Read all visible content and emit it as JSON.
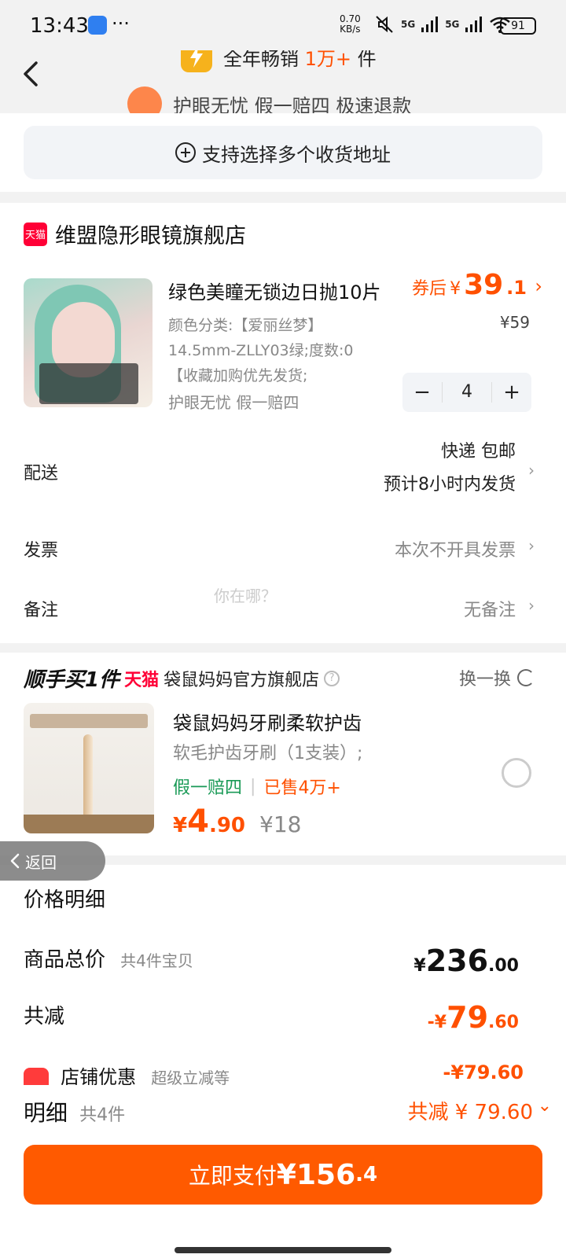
{
  "status_bar": {
    "time": "13:43",
    "dots": "···",
    "net_speed_top": "0.70",
    "net_speed_bottom": "KB/s",
    "signal1": "5G",
    "signal2": "5G",
    "battery": "91"
  },
  "top_banner": {
    "promo1_prefix": "全年畅销",
    "promo1_highlight": "1万+",
    "promo1_suffix": "件",
    "promo2": "护眼无忧 假一赔四 极速退款"
  },
  "address": {
    "label": "支持选择多个收货地址"
  },
  "shop": {
    "badge": "天猫",
    "name": "维盟隐形眼镜旗舰店",
    "product": {
      "title": "绿色美瞳无锁边日抛10片",
      "coupon_prefix": "券后",
      "coupon_currency": "¥",
      "coupon_int": "39",
      "coupon_dec": ".1",
      "orig_price": "¥59",
      "spec_line1": "颜色分类:【爱丽丝梦】",
      "spec_line2": "14.5mm-ZLLY03绿;度数:0",
      "spec_line3": "【收藏加购优先发货;",
      "tags": "护眼无忧  假一赔四",
      "quantity": "4",
      "minus": "−",
      "plus": "+"
    },
    "shipping_label": "配送",
    "shipping_value1": "快递 包邮",
    "shipping_value2": "预计8小时内发货",
    "invoice_label": "发票",
    "invoice_value": "本次不开具发票",
    "note_label": "备注",
    "note_value": "无备注",
    "ghost_text": "你在哪？"
  },
  "addon": {
    "brand": "顺手买1件",
    "tmall": "天猫",
    "shop": "袋鼠妈妈官方旗舰店",
    "help": "?",
    "swap": "换一换",
    "title": "袋鼠妈妈牙刷柔软护齿",
    "spec": "软毛护齿牙刷（1支装）;",
    "tag1": "假一赔四",
    "tag_sep": "|",
    "tag2": "已售4万+",
    "price_cur": "¥",
    "price_int": "4",
    "price_dec": ".90",
    "orig_price": "¥18"
  },
  "back_float": "返回",
  "price_detail": {
    "title": "价格明细",
    "total_label": "商品总价",
    "total_sub": "共4件宝贝",
    "total_cur": "¥",
    "total_int": "236",
    "total_dec": ".00",
    "less_label": "共减",
    "less_cur": "-¥",
    "less_int": "79",
    "less_dec": ".60",
    "shop_disc_label": "店铺优惠",
    "shop_disc_sub": "超级立减等",
    "shop_disc_value": "-¥79.60"
  },
  "summary": {
    "label": "明细",
    "count": "共4件",
    "reduction": "共减 ¥ 79.60",
    "pay_label": "立即支付",
    "pay_amount": "¥156",
    "pay_dec": ".4"
  },
  "colors": {
    "accent": "#ff5000",
    "pay_button": "#ff5a00",
    "tmall": "#ff0036",
    "green_tag": "#1a9a57"
  }
}
